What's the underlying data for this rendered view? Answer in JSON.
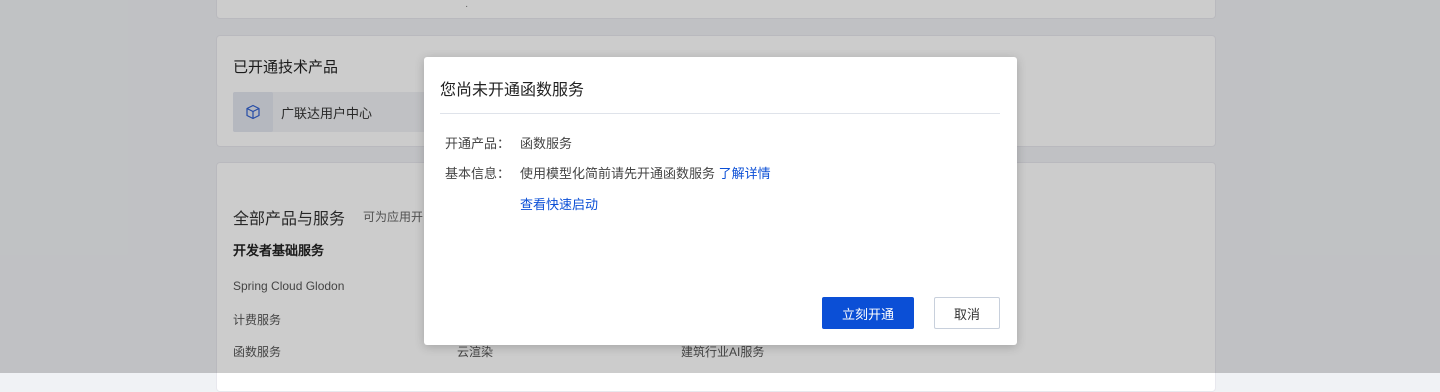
{
  "background": {
    "top_card_dot": "·",
    "enabled_products": {
      "title": "已开通技术产品",
      "items": [
        {
          "label": "广联达用户中心",
          "icon": "cube-icon"
        }
      ]
    },
    "all_products": {
      "title": "全部产品与服务",
      "subtitle": "可为应用开",
      "section_title": "开发者基础服务",
      "services_col1": [
        "Spring Cloud Glodon",
        "计费服务",
        "函数服务"
      ],
      "services_col2_partial": "云渲染",
      "services_col3_partial": "建筑行业AI服务"
    }
  },
  "modal": {
    "title": "您尚未开通函数服务",
    "rows": [
      {
        "label": "开通产品：",
        "value": "函数服务"
      },
      {
        "label": "基本信息：",
        "value": "使用模型化简前请先开通函数服务",
        "link": "了解详情"
      }
    ],
    "quickstart_link": "查看快速启动",
    "confirm_label": "立刻开通",
    "cancel_label": "取消"
  },
  "colors": {
    "accent": "#0b4fd6",
    "overlay": "rgba(0,0,0,0.2)"
  }
}
